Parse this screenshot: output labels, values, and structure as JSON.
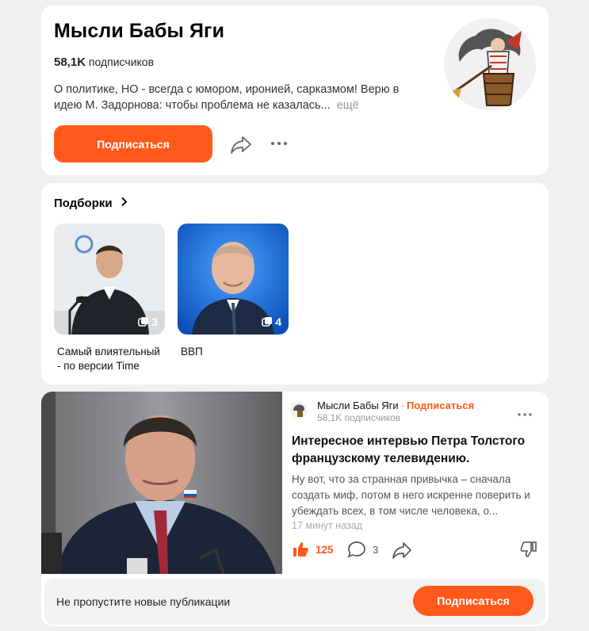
{
  "channel": {
    "title": "Мысли Бабы Яги",
    "subscribers_count": "58,1K",
    "subscribers_label": "подписчиков",
    "description": "О политике, НО - всегда с юмором, иронией, сарказмом! Верю в идею М. Задорнова: чтобы проблема не казалась...",
    "more_label": "ещё",
    "subscribe_label": "Подписаться"
  },
  "collections": {
    "title": "Подборки",
    "items": [
      {
        "label": "Самый влиятельный - по версии Time",
        "count": "3"
      },
      {
        "label": "ВВП",
        "count": "4"
      }
    ]
  },
  "article": {
    "channel_name": "Мысли Бабы Яги",
    "separator": "·",
    "subscribe_link": "Подписаться",
    "subscribers": "58,1K подписчиков",
    "title": "Интересное интервью Петра Толстого французскому телевидению.",
    "excerpt": "Ну вот, что за странная привычка – сначала создать миф, потом в него искренне поверить и убеждать всех, в том числе человека, о...",
    "time": "17 минут назад",
    "likes": "125",
    "comments": "3"
  },
  "footer": {
    "text": "Не пропустите новые публикации",
    "subscribe_label": "Подписаться"
  },
  "colors": {
    "accent": "#ff5a1c",
    "background": "#efeff1"
  }
}
